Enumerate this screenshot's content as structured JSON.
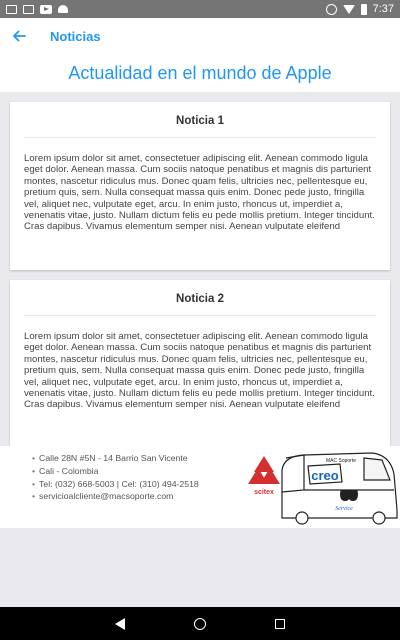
{
  "status_bar": {
    "time": "7:37"
  },
  "app_bar": {
    "title": "Noticias"
  },
  "page": {
    "heading": "Actualidad en el mundo de Apple"
  },
  "news": [
    {
      "title": "Noticia 1",
      "body": "Lorem ipsum dolor sit amet, consectetuer adipiscing elit. Aenean commodo ligula eget dolor. Aenean massa. Cum sociis natoque penatibus et magnis dis parturient montes, nascetur ridiculus mus. Donec quam felis, ultricies nec, pellentesque eu, pretium quis, sem. Nulla consequat massa quis enim. Donec pede justo, fringilla vel, aliquet nec, vulputate eget, arcu. In enim justo, rhoncus ut, imperdiet a, venenatis vitae, justo. Nullam dictum felis eu pede mollis pretium. Integer tincidunt. Cras dapibus. Vivamus elementum semper nisi. Aenean vulputate eleifend"
    },
    {
      "title": "Noticia 2",
      "body": "Lorem ipsum dolor sit amet, consectetuer adipiscing elit. Aenean commodo ligula eget dolor. Aenean massa. Cum sociis natoque penatibus et magnis dis parturient montes, nascetur ridiculus mus. Donec quam felis, ultricies nec, pellentesque eu, pretium quis, sem. Nulla consequat massa quis enim. Donec pede justo, fringilla vel, aliquet nec, vulputate eget, arcu. In enim justo, rhoncus ut, imperdiet a, venenatis vitae, justo. Nullam dictum felis eu pede mollis pretium. Integer tincidunt. Cras dapibus. Vivamus elementum semper nisi. Aenean vulputate eleifend"
    }
  ],
  "contact": {
    "address": "Calle 28N #5N - 14 Barrio San Vicente",
    "city": "Cali - Colombia",
    "phone": "Tel: (032) 668-5003 | Cel: (310) 494-2518",
    "email": "servicioalcliente@macsoporte.com"
  },
  "logo": {
    "brand_left": "scitex",
    "brand_main": "creo",
    "van_label": "MAC Soporte",
    "service": "Service"
  },
  "colors": {
    "accent": "#2196f3",
    "status_bar": "#757575",
    "nav_bar": "#000000"
  }
}
